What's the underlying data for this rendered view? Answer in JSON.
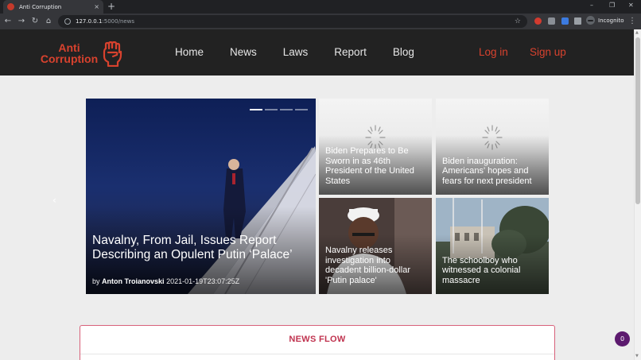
{
  "browser": {
    "tab_title": "Anti Corruption",
    "tab_close": "×",
    "new_tab": "+",
    "win_min": "–",
    "win_max": "❐",
    "win_close": "✕",
    "back": "←",
    "forward": "→",
    "reload": "↻",
    "home": "⌂",
    "url_host": "127.0.0.1",
    "url_path": ":5000/news",
    "star": "☆",
    "incognito_label": "Incognito",
    "menu": "⋮"
  },
  "header": {
    "logo_line1": "Anti",
    "logo_line2": "Corruption",
    "nav": [
      {
        "label": "Home"
      },
      {
        "label": "News"
      },
      {
        "label": "Laws"
      },
      {
        "label": "Report"
      },
      {
        "label": "Blog"
      }
    ],
    "login": "Log in",
    "signup": "Sign up"
  },
  "carousel": {
    "title": "Navalny, From Jail, Issues Report Describing an Opulent Putin ‘Palace’",
    "by": "by",
    "author": "Anton Troianovski",
    "date": "2021-01-19T23:07:25Z",
    "prev": "‹",
    "next": "›"
  },
  "cards": [
    {
      "title": "Biden Prepares to Be Sworn in as 46th President of the United States"
    },
    {
      "title": "Biden inauguration: Americans' hopes and fears for next president"
    },
    {
      "title": "Navalny releases investigation into decadent billion-dollar 'Putin palace'"
    },
    {
      "title": "The schoolboy who witnessed a colonial massacre"
    }
  ],
  "news_flow": {
    "title": "NEWS FLOW"
  },
  "chat": {
    "count": "0"
  },
  "colors": {
    "accent": "#d8422e",
    "header_bg": "#222222",
    "news_flow": "#c0334f"
  }
}
